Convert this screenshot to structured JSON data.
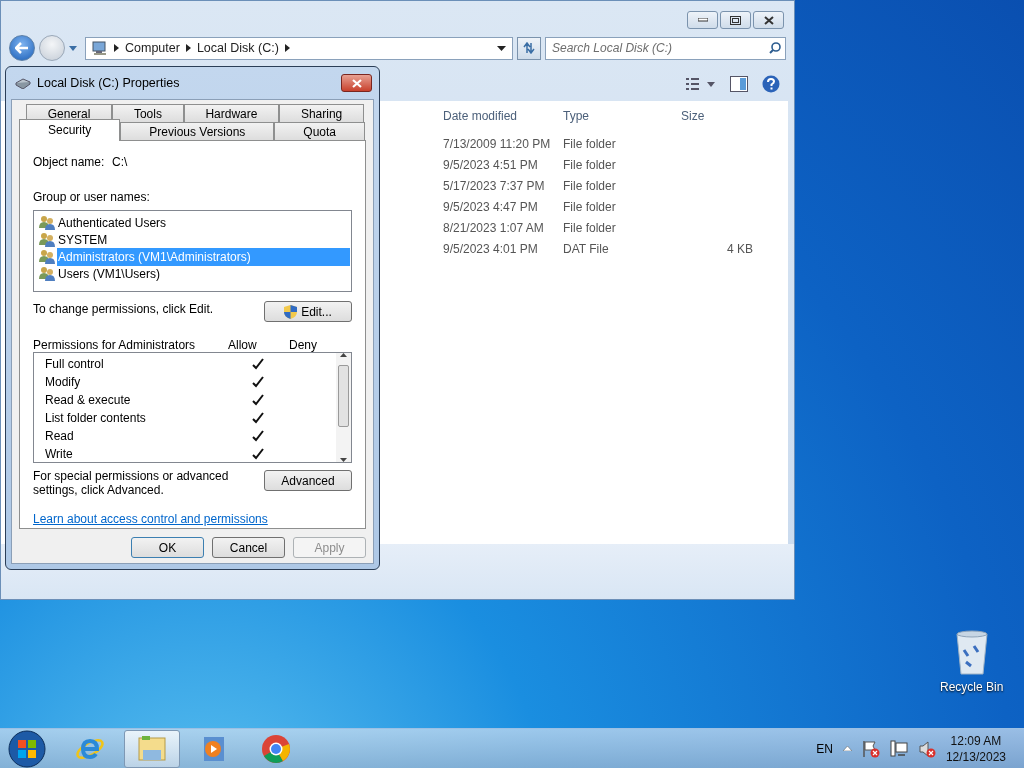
{
  "explorer": {
    "breadcrumb": [
      "Computer",
      "Local Disk (C:)"
    ],
    "search": {
      "placeholder": "Search Local Disk (C:)"
    },
    "columns": [
      "Date modified",
      "Type",
      "Size"
    ],
    "rows": [
      {
        "date": "7/13/2009 11:20 PM",
        "type": "File folder"
      },
      {
        "date": "9/5/2023 4:51 PM",
        "type": "File folder"
      },
      {
        "date": "5/17/2023 7:37 PM",
        "type": "File folder"
      },
      {
        "date": "9/5/2023 4:47 PM",
        "type": "File folder"
      },
      {
        "date": "8/21/2023 1:07 AM",
        "type": "File folder"
      },
      {
        "date": "9/5/2023 4:01 PM",
        "type": "DAT File",
        "size": "4 KB"
      }
    ]
  },
  "dialog": {
    "title": "Local Disk (C:) Properties",
    "tab_rows": [
      [
        {
          "label": "General",
          "selected": false
        },
        {
          "label": "Tools",
          "selected": false
        },
        {
          "label": "Hardware",
          "selected": false
        },
        {
          "label": "Sharing",
          "selected": false
        }
      ],
      [
        {
          "label": "Security",
          "selected": true
        },
        {
          "label": "Previous Versions",
          "selected": false
        },
        {
          "label": "Quota",
          "selected": false
        }
      ]
    ],
    "object_name_label": "Object name:",
    "object_name": "C:\\",
    "group_label": "Group or user names:",
    "users": [
      {
        "name": "Authenticated Users",
        "selected": false
      },
      {
        "name": "SYSTEM",
        "selected": false
      },
      {
        "name": "Administrators (VM1\\Administrators)",
        "selected": true
      },
      {
        "name": "Users (VM1\\Users)",
        "selected": false
      }
    ],
    "change_text": "To change permissions, click Edit.",
    "edit_button": "Edit...",
    "permissions_label": "Permissions for Administrators",
    "allow_label": "Allow",
    "deny_label": "Deny",
    "permissions": [
      {
        "name": "Full control",
        "allow": true,
        "deny": false
      },
      {
        "name": "Modify",
        "allow": true,
        "deny": false
      },
      {
        "name": "Read & execute",
        "allow": true,
        "deny": false
      },
      {
        "name": "List folder contents",
        "allow": true,
        "deny": false
      },
      {
        "name": "Read",
        "allow": true,
        "deny": false
      },
      {
        "name": "Write",
        "allow": true,
        "deny": false
      }
    ],
    "advanced_text": "For special permissions or advanced settings, click Advanced.",
    "advanced_button": "Advanced",
    "link": "Learn about access control and permissions",
    "buttons": [
      {
        "label": "OK",
        "disabled": false
      },
      {
        "label": "Cancel",
        "disabled": false
      },
      {
        "label": "Apply",
        "disabled": true
      }
    ]
  },
  "desktop": {
    "icons": [
      {
        "label": "Recycle Bin"
      }
    ]
  },
  "taskbar": {
    "apps": [
      {
        "kind": "ie",
        "active": false
      },
      {
        "kind": "explorer",
        "active": true
      },
      {
        "kind": "media",
        "active": false
      },
      {
        "kind": "chrome",
        "active": false
      }
    ],
    "language": "EN",
    "time": "12:09 AM",
    "date": "12/13/2023"
  }
}
